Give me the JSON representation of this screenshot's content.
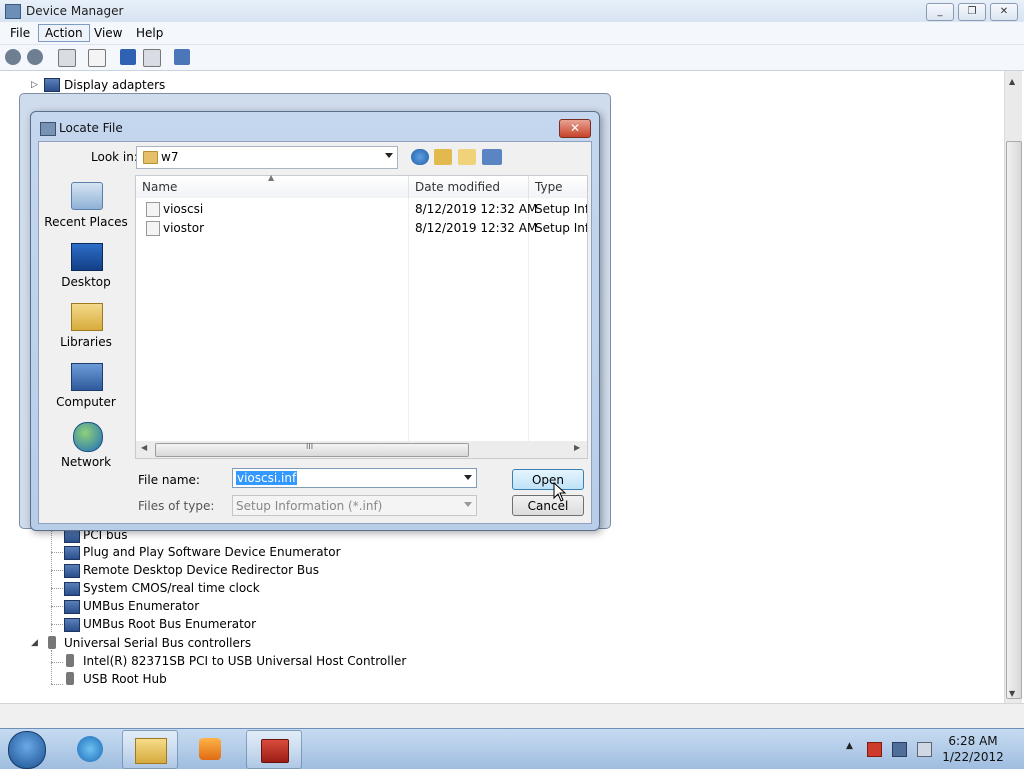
{
  "window": {
    "title": "Device Manager",
    "controls": [
      "_",
      "❐",
      "✕"
    ]
  },
  "menubar": [
    "File",
    "Action",
    "View",
    "Help"
  ],
  "tree": {
    "top_item": "Display adapters",
    "system_devices": [
      "PCI bus",
      "Plug and Play Software Device Enumerator",
      "Remote Desktop Device Redirector Bus",
      "System CMOS/real time clock",
      "UMBus Enumerator",
      "UMBus Root Bus Enumerator"
    ],
    "usb_category": "Universal Serial Bus controllers",
    "usb_devices": [
      "Intel(R) 82371SB PCI to USB Universal Host Controller",
      "USB Root Hub"
    ]
  },
  "dialog": {
    "title": "Locate File",
    "close": "✕",
    "look_in_label": "Look in:",
    "look_in_value": "w7",
    "places": [
      "Recent Places",
      "Desktop",
      "Libraries",
      "Computer",
      "Network"
    ],
    "columns": [
      "Name",
      "Date modified",
      "Type"
    ],
    "files": [
      {
        "name": "vioscsi",
        "date": "8/12/2019 12:32 AM",
        "type": "Setup Infc"
      },
      {
        "name": "viostor",
        "date": "8/12/2019 12:32 AM",
        "type": "Setup Infc"
      }
    ],
    "file_name_label": "File name:",
    "file_name_value": "vioscsi.inf",
    "files_of_type_label": "Files of type:",
    "files_of_type_value": "Setup Information (*.inf)",
    "open_button": "Open",
    "cancel_button": "Cancel",
    "scroll_grip": "III"
  },
  "taskbar": {
    "time": "6:28 AM",
    "date": "1/22/2012"
  },
  "colors": {
    "accent": "#3399ff",
    "dialog_frame": "#b7cde8",
    "taskbar": "#9fbde0"
  }
}
